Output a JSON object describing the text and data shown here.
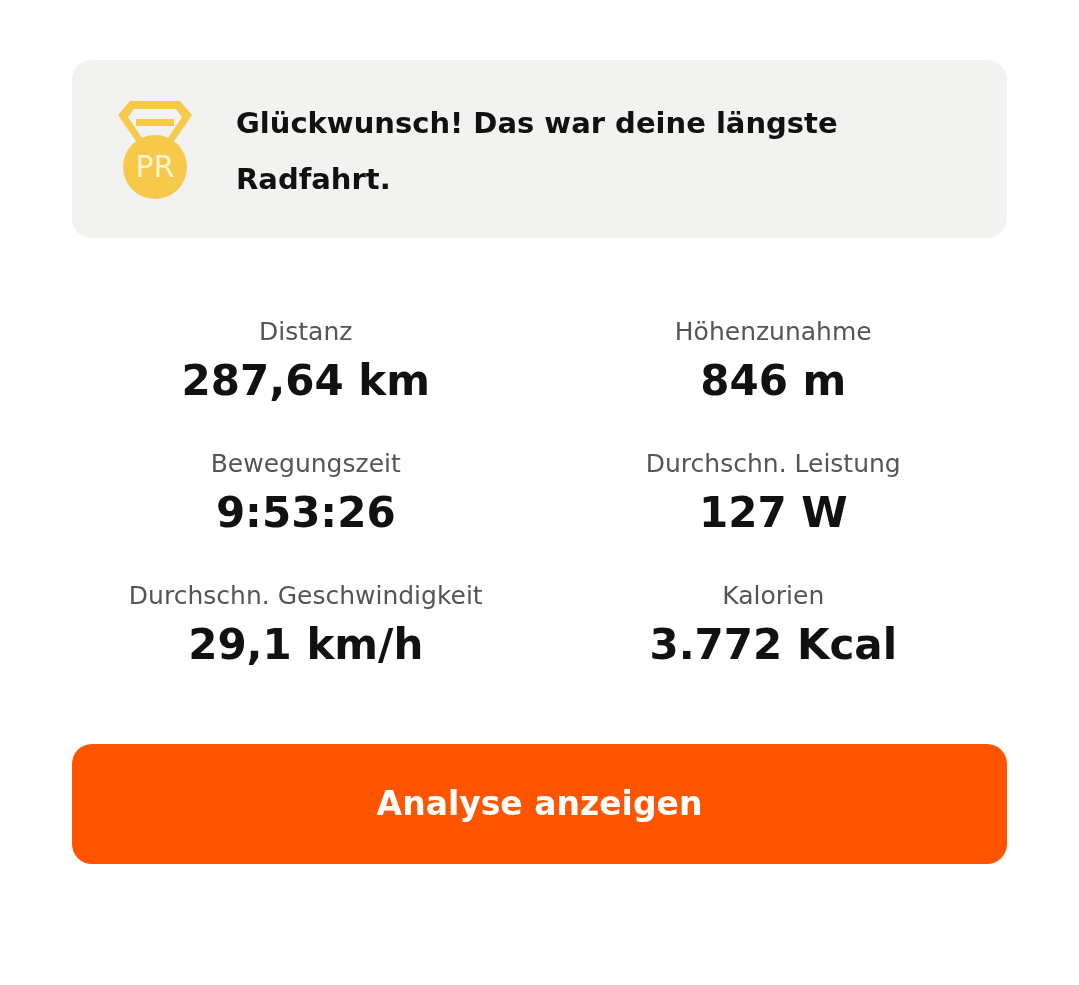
{
  "achievement": {
    "badge": "PR",
    "message": "Glückwunsch! Das war deine längste Radfahrt."
  },
  "stats": [
    {
      "label": "Distanz",
      "value": "287,64 km"
    },
    {
      "label": "Höhenzunahme",
      "value": "846 m"
    },
    {
      "label": "Bewegungszeit",
      "value": "9:53:26"
    },
    {
      "label": "Durchschn. Leistung",
      "value": "127 W"
    },
    {
      "label": "Durchschn. Geschwindigkeit",
      "value": "29,1 km/h"
    },
    {
      "label": "Kalorien",
      "value": "3.772 Kcal"
    }
  ],
  "button": {
    "label": "Analyse anzeigen"
  }
}
